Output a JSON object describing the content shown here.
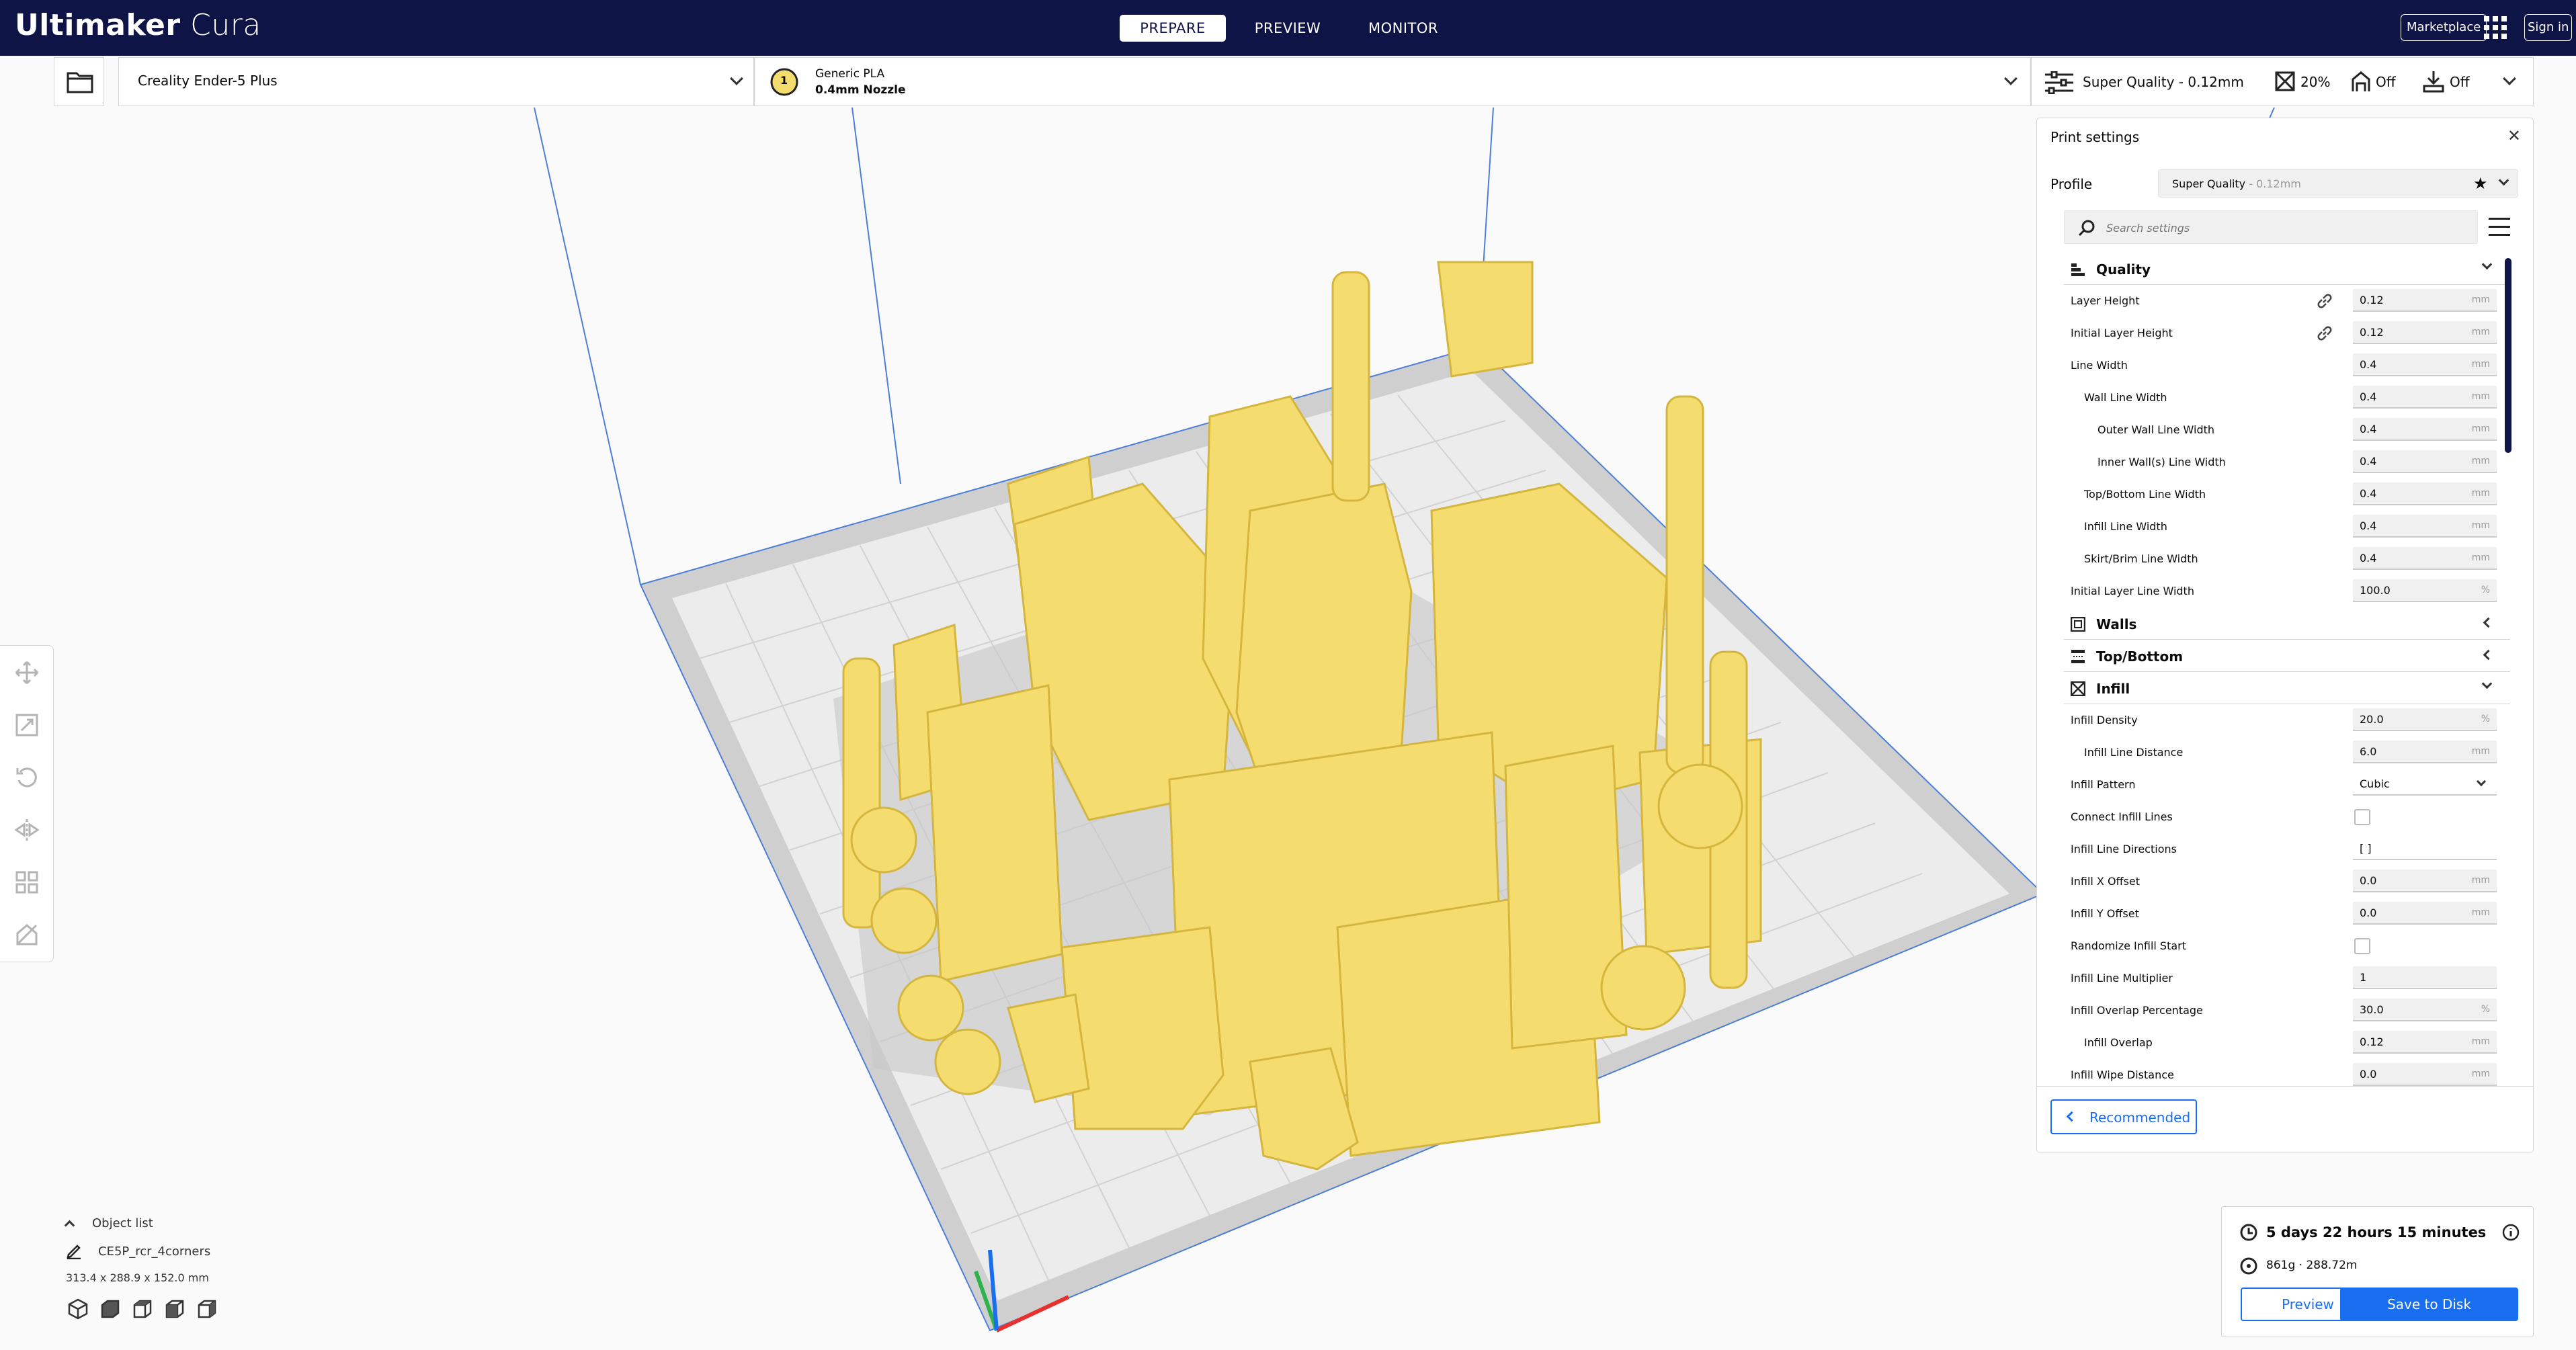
{
  "app": {
    "title_bold": "Ultimaker",
    "title_light": "Cura"
  },
  "stages": [
    {
      "label": "PREPARE",
      "active": true
    },
    {
      "label": "PREVIEW",
      "active": false
    },
    {
      "label": "MONITOR",
      "active": false
    }
  ],
  "header_buttons": {
    "marketplace": "Marketplace",
    "sign_in": "Sign in"
  },
  "printer": {
    "name": "Creality Ender-5 Plus"
  },
  "extruder": {
    "number": "1",
    "material": "Generic PLA",
    "nozzle": "0.4mm Nozzle"
  },
  "print_setup": {
    "profile": "Super Quality - 0.12mm",
    "infill": "20%",
    "support": "Off",
    "adhesion": "Off"
  },
  "print_settings": {
    "title": "Print settings",
    "profile_label": "Profile",
    "profile_value": "Super Quality",
    "profile_suffix": " - 0.12mm",
    "search_placeholder": "Search settings",
    "recommended_label": "Recommended",
    "categories": {
      "quality": "Quality",
      "walls": "Walls",
      "top_bottom": "Top/Bottom",
      "infill": "Infill"
    },
    "quality_rows": [
      {
        "label": "Layer Height",
        "value": "0.12",
        "unit": "mm"
      },
      {
        "label": "Initial Layer Height",
        "value": "0.12",
        "unit": "mm"
      },
      {
        "label": "Line Width",
        "value": "0.4",
        "unit": "mm"
      },
      {
        "label": "Wall Line Width",
        "value": "0.4",
        "unit": "mm"
      },
      {
        "label": "Outer Wall Line Width",
        "value": "0.4",
        "unit": "mm"
      },
      {
        "label": "Inner Wall(s) Line Width",
        "value": "0.4",
        "unit": "mm"
      },
      {
        "label": "Top/Bottom Line Width",
        "value": "0.4",
        "unit": "mm"
      },
      {
        "label": "Infill Line Width",
        "value": "0.4",
        "unit": "mm"
      },
      {
        "label": "Skirt/Brim Line Width",
        "value": "0.4",
        "unit": "mm"
      },
      {
        "label": "Initial Layer Line Width",
        "value": "100.0",
        "unit": "%"
      }
    ],
    "infill_rows": [
      {
        "label": "Infill Density",
        "value": "20.0",
        "unit": "%"
      },
      {
        "label": "Infill Line Distance",
        "value": "6.0",
        "unit": "mm"
      },
      {
        "label": "Infill Pattern",
        "value": "Cubic",
        "unit": ""
      },
      {
        "label": "Connect Infill Lines",
        "value": "",
        "unit": ""
      },
      {
        "label": "Infill Line Directions",
        "value": "[ ]",
        "unit": ""
      },
      {
        "label": "Infill X Offset",
        "value": "0.0",
        "unit": "mm"
      },
      {
        "label": "Infill Y Offset",
        "value": "0.0",
        "unit": "mm"
      },
      {
        "label": "Randomize Infill Start",
        "value": "",
        "unit": ""
      },
      {
        "label": "Infill Line Multiplier",
        "value": "1",
        "unit": ""
      },
      {
        "label": "Infill Overlap Percentage",
        "value": "30.0",
        "unit": "%"
      },
      {
        "label": "Infill Overlap",
        "value": "0.12",
        "unit": "mm"
      },
      {
        "label": "Infill Wipe Distance",
        "value": "0.0",
        "unit": "mm"
      }
    ]
  },
  "estimate": {
    "time": "5 days 22 hours 15 minutes",
    "material": "861g · 288.72m",
    "preview_label": "Preview",
    "save_label": "Save to Disk"
  },
  "object_list": {
    "title": "Object list",
    "name": "CE5P_rcr_4corners",
    "dimensions": "313.4 x 288.9 x 152.0 mm"
  },
  "colors": {
    "header": "#0f1446",
    "accent": "#196ef0",
    "model": "#f5dc6e",
    "plate": "#d9d9d9"
  }
}
